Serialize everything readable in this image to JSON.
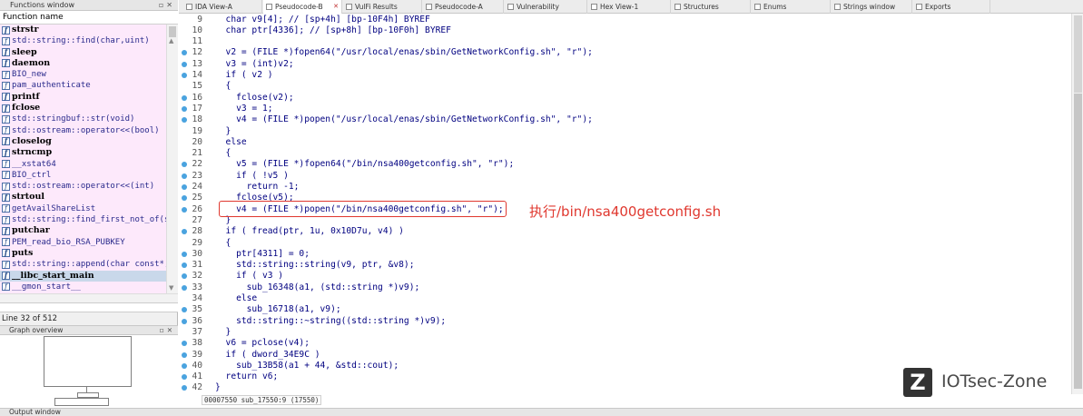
{
  "functions_window": {
    "title": "Functions window",
    "column_header": "Function name",
    "items": [
      {
        "name": "strstr",
        "kind": "imp"
      },
      {
        "name": "std::string::find(char,uint)",
        "kind": "lib"
      },
      {
        "name": "sleep",
        "kind": "imp"
      },
      {
        "name": "daemon",
        "kind": "imp"
      },
      {
        "name": "BIO_new",
        "kind": "lib"
      },
      {
        "name": "pam_authenticate",
        "kind": "lib"
      },
      {
        "name": "printf",
        "kind": "imp"
      },
      {
        "name": "fclose",
        "kind": "imp"
      },
      {
        "name": "std::stringbuf::str(void)",
        "kind": "lib"
      },
      {
        "name": "std::ostream::operator<<(bool)",
        "kind": "lib"
      },
      {
        "name": "closelog",
        "kind": "imp"
      },
      {
        "name": "strncmp",
        "kind": "imp"
      },
      {
        "name": "__xstat64",
        "kind": "lib"
      },
      {
        "name": "BIO_ctrl",
        "kind": "lib"
      },
      {
        "name": "std::ostream::operator<<(int)",
        "kind": "lib"
      },
      {
        "name": "strtoul",
        "kind": "imp"
      },
      {
        "name": "getAvailShareList",
        "kind": "lib"
      },
      {
        "name": "std::string::find_first_not_of(s",
        "kind": "lib"
      },
      {
        "name": "putchar",
        "kind": "imp"
      },
      {
        "name": "PEM_read_bio_RSA_PUBKEY",
        "kind": "lib"
      },
      {
        "name": "puts",
        "kind": "imp"
      },
      {
        "name": "std::string::append(char const*,",
        "kind": "lib"
      },
      {
        "name": "__libc_start_main",
        "kind": "imp",
        "selected": true
      },
      {
        "name": "__gmon_start__",
        "kind": "lib"
      }
    ],
    "line_info": "Line 32 of 512"
  },
  "graph_overview": {
    "title": "Graph overview"
  },
  "output_window": {
    "title": "Output window"
  },
  "tabs": [
    {
      "label": "IDA View-A"
    },
    {
      "label": "Pseudocode-B",
      "active": true
    },
    {
      "label": "VulFi Results"
    },
    {
      "label": "Pseudocode-A"
    },
    {
      "label": "Vulnerability"
    },
    {
      "label": "Hex View-1"
    },
    {
      "label": "Structures"
    },
    {
      "label": "Enums"
    },
    {
      "label": "Strings window"
    },
    {
      "label": "Exports"
    }
  ],
  "code_lines": [
    {
      "n": "9",
      "dot": false,
      "text": "  char v9[4]; // [sp+4h] [bp-10F4h] BYREF"
    },
    {
      "n": "10",
      "dot": false,
      "text": "  char ptr[4336]; // [sp+8h] [bp-10F0h] BYREF"
    },
    {
      "n": "11",
      "dot": false,
      "text": ""
    },
    {
      "n": "12",
      "dot": true,
      "text": "  v2 = (FILE *)fopen64(\"/usr/local/enas/sbin/GetNetworkConfig.sh\", \"r\");"
    },
    {
      "n": "13",
      "dot": true,
      "text": "  v3 = (int)v2;"
    },
    {
      "n": "14",
      "dot": true,
      "text": "  if ( v2 )"
    },
    {
      "n": "15",
      "dot": false,
      "text": "  {"
    },
    {
      "n": "16",
      "dot": true,
      "text": "    fclose(v2);"
    },
    {
      "n": "17",
      "dot": true,
      "text": "    v3 = 1;"
    },
    {
      "n": "18",
      "dot": true,
      "text": "    v4 = (FILE *)popen(\"/usr/local/enas/sbin/GetNetworkConfig.sh\", \"r\");"
    },
    {
      "n": "19",
      "dot": false,
      "text": "  }"
    },
    {
      "n": "20",
      "dot": false,
      "text": "  else"
    },
    {
      "n": "21",
      "dot": false,
      "text": "  {"
    },
    {
      "n": "22",
      "dot": true,
      "text": "    v5 = (FILE *)fopen64(\"/bin/nsa400getconfig.sh\", \"r\");"
    },
    {
      "n": "23",
      "dot": true,
      "text": "    if ( !v5 )"
    },
    {
      "n": "24",
      "dot": true,
      "text": "      return -1;"
    },
    {
      "n": "25",
      "dot": true,
      "text": "    fclose(v5);"
    },
    {
      "n": "26",
      "dot": true,
      "text": "    v4 = (FILE *)popen(\"/bin/nsa400getconfig.sh\", \"r\");"
    },
    {
      "n": "27",
      "dot": false,
      "text": "  }"
    },
    {
      "n": "28",
      "dot": true,
      "text": "  if ( fread(ptr, 1u, 0x10D7u, v4) )"
    },
    {
      "n": "29",
      "dot": false,
      "text": "  {"
    },
    {
      "n": "30",
      "dot": true,
      "text": "    ptr[4311] = 0;"
    },
    {
      "n": "31",
      "dot": true,
      "text": "    std::string::string(v9, ptr, &v8);"
    },
    {
      "n": "32",
      "dot": true,
      "text": "    if ( v3 )"
    },
    {
      "n": "33",
      "dot": true,
      "text": "      sub_16348(a1, (std::string *)v9);"
    },
    {
      "n": "34",
      "dot": false,
      "text": "    else"
    },
    {
      "n": "35",
      "dot": true,
      "text": "      sub_16718(a1, v9);"
    },
    {
      "n": "36",
      "dot": true,
      "text": "    std::string::~string((std::string *)v9);"
    },
    {
      "n": "37",
      "dot": false,
      "text": "  }"
    },
    {
      "n": "38",
      "dot": true,
      "text": "  v6 = pclose(v4);"
    },
    {
      "n": "39",
      "dot": true,
      "text": "  if ( dword_34E9C )"
    },
    {
      "n": "40",
      "dot": true,
      "text": "    sub_13B58(a1 + 44, &std::cout);"
    },
    {
      "n": "41",
      "dot": true,
      "text": "  return v6;"
    },
    {
      "n": "42",
      "dot": true,
      "text": "}"
    }
  ],
  "annotation": "执行/bin/nsa400getconfig.sh",
  "status_bar": "00007550 sub_17550:9 (17550)",
  "watermark": {
    "logo_letter": "Z",
    "text": "IOTsec-Zone"
  },
  "colors": {
    "highlight_box": "#e0382f",
    "function_list_bg": "#fde9fb",
    "line_dot": "#4aa3df"
  }
}
